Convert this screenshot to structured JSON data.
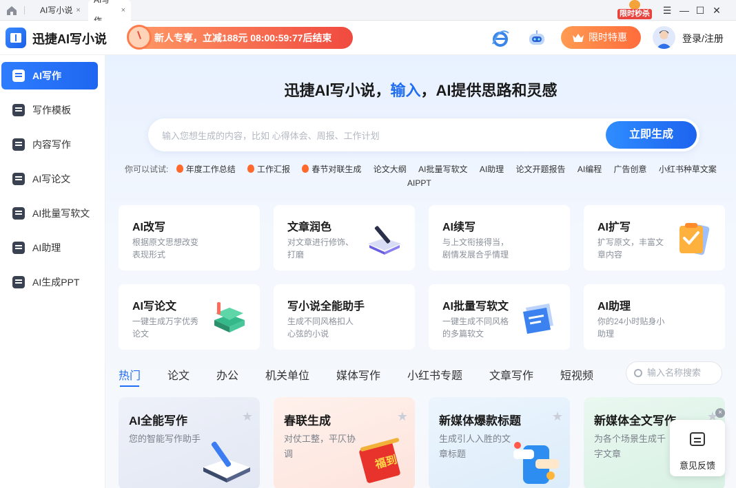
{
  "titlebar": {
    "tabs": [
      {
        "label": "AI写小说",
        "close": "×"
      },
      {
        "label": "AI写作",
        "close": "×"
      }
    ],
    "promo_badge": "限时秒杀",
    "window_controls": {
      "menu": "☰",
      "minimize": "—",
      "maximize": "☐",
      "close": "✕"
    }
  },
  "header": {
    "app_name": "迅捷AI写小说",
    "countdown_text": "新人专享，立减188元 08:00:59:77后结束",
    "limited_offer_label": "限时特惠",
    "login_label": "登录/注册"
  },
  "sidebar": {
    "items": [
      {
        "label": "AI写作",
        "icon": "ai-write-icon",
        "active": true
      },
      {
        "label": "写作模板",
        "icon": "template-icon",
        "active": false
      },
      {
        "label": "内容写作",
        "icon": "content-write-icon",
        "active": false
      },
      {
        "label": "AI写论文",
        "icon": "paper-icon",
        "active": false
      },
      {
        "label": "AI批量写软文",
        "icon": "batch-icon",
        "active": false
      },
      {
        "label": "AI助理",
        "icon": "assistant-icon",
        "active": false
      },
      {
        "label": "AI生成PPT",
        "icon": "ppt-icon",
        "active": false
      }
    ]
  },
  "main": {
    "headline_prefix": "迅捷AI写小说，",
    "headline_highlight": "输入",
    "headline_suffix": "，AI提供思路和灵感",
    "search_placeholder": "输入您想生成的内容，比如 心得体会、周报、工作计划",
    "generate_button": "立即生成",
    "tries_label": "你可以试试:",
    "tries": [
      {
        "label": "年度工作总结",
        "hot": true
      },
      {
        "label": "工作汇报",
        "hot": true
      },
      {
        "label": "春节对联生成",
        "hot": true
      },
      {
        "label": "论文大纲",
        "hot": false
      },
      {
        "label": "AI批量写软文",
        "hot": false
      },
      {
        "label": "AI助理",
        "hot": false
      },
      {
        "label": "论文开题报告",
        "hot": false
      },
      {
        "label": "AI编程",
        "hot": false
      },
      {
        "label": "广告创意",
        "hot": false
      },
      {
        "label": "小红书种草文案",
        "hot": false
      },
      {
        "label": "AIPPT",
        "hot": false
      }
    ],
    "tools": [
      {
        "title": "AI改写",
        "desc": "根据原文思想改变表现形式"
      },
      {
        "title": "文章润色",
        "desc": "对文章进行修饰、打磨"
      },
      {
        "title": "AI续写",
        "desc": "与上文衔接得当，剧情发展合乎情理"
      },
      {
        "title": "AI扩写",
        "desc": "扩写原文，丰富文章内容"
      },
      {
        "title": "AI写论文",
        "desc": "一键生成万字优秀论文"
      },
      {
        "title": "写小说全能助手",
        "desc": "生成不同风格扣人心弦的小说"
      },
      {
        "title": "AI批量写软文",
        "desc": "一键生成不同风格的多篇软文"
      },
      {
        "title": "AI助理",
        "desc": "你的24小时贴身小助理"
      }
    ],
    "category_tabs": [
      "热门",
      "论文",
      "办公",
      "机关单位",
      "媒体写作",
      "小红书专题",
      "文章写作",
      "短视频"
    ],
    "category_search_placeholder": "输入名称搜索",
    "templates": [
      {
        "title": "AI全能写作",
        "desc": "您的智能写作助手",
        "bg": "#e9edf7"
      },
      {
        "title": "春联生成",
        "desc": "对仗工整，平仄协调",
        "bg": "#fdeeea"
      },
      {
        "title": "新媒体爆款标题",
        "desc": "生成引人入胜的文章标题",
        "bg": "#e6f1fb"
      },
      {
        "title": "新媒体全文写作",
        "desc": "为各个场景生成千字文章",
        "bg": "#e6f6ee"
      }
    ],
    "template_art_text": "福到"
  },
  "feedback_label": "意见反馈",
  "feedback_close": "×",
  "colors": {
    "accent": "#1f6df2",
    "promo": "#ff6c3b",
    "hot": "#ff6a2c"
  }
}
